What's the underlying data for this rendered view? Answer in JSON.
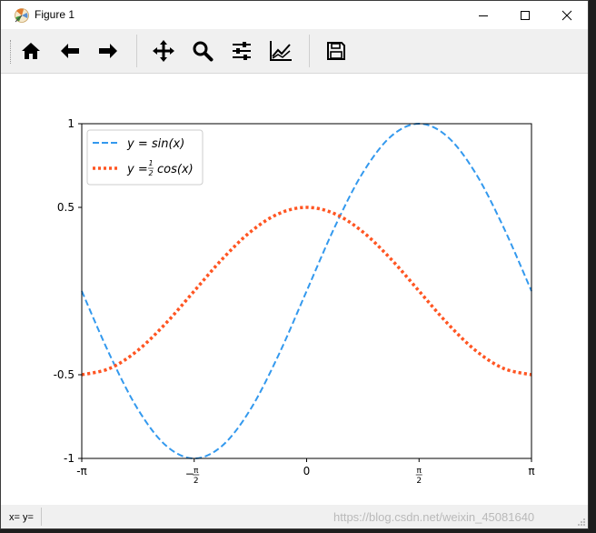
{
  "window": {
    "title": "Figure 1",
    "controls": [
      "minimize",
      "maximize",
      "close"
    ]
  },
  "toolbar": {
    "buttons": [
      {
        "name": "home",
        "icon": "home-icon"
      },
      {
        "name": "back",
        "icon": "arrow-left-icon"
      },
      {
        "name": "forward",
        "icon": "arrow-right-icon"
      },
      {
        "name": "pan",
        "icon": "move-icon"
      },
      {
        "name": "zoom",
        "icon": "magnifier-icon"
      },
      {
        "name": "configure-subplots",
        "icon": "sliders-icon"
      },
      {
        "name": "edit-axes",
        "icon": "line-chart-icon"
      },
      {
        "name": "save",
        "icon": "floppy-disk-icon"
      }
    ]
  },
  "status": {
    "coords": "x= y=",
    "watermark": "https://blog.csdn.net/weixin_45081640"
  },
  "colors": {
    "sin": "#3399ee",
    "cos": "#ff5522",
    "toolbar_bg": "#f0f0f0"
  },
  "chart_data": {
    "type": "line",
    "xlim": [
      -3.14159,
      3.14159
    ],
    "ylim": [
      -1,
      1
    ],
    "x_ticks": [
      {
        "value": -3.14159,
        "label": "-π"
      },
      {
        "value": -1.5708,
        "label": "-π/2"
      },
      {
        "value": 0,
        "label": "0"
      },
      {
        "value": 1.5708,
        "label": "π/2"
      },
      {
        "value": 3.14159,
        "label": "π"
      }
    ],
    "y_ticks": [
      {
        "value": -1,
        "label": "-1"
      },
      {
        "value": -0.5,
        "label": "-0.5"
      },
      {
        "value": 0.5,
        "label": "0.5"
      },
      {
        "value": 1,
        "label": "1"
      }
    ],
    "series": [
      {
        "name": "y = sin(x)",
        "style": "dashed",
        "color": "#3399ee",
        "x": [
          -3.1416,
          -2.7489,
          -2.3562,
          -1.9635,
          -1.5708,
          -1.1781,
          -0.7854,
          -0.3927,
          0,
          0.3927,
          0.7854,
          1.1781,
          1.5708,
          1.9635,
          2.3562,
          2.7489,
          3.1416
        ],
        "y": [
          0,
          -0.3827,
          -0.7071,
          -0.9239,
          -1,
          -0.9239,
          -0.7071,
          -0.3827,
          0,
          0.3827,
          0.7071,
          0.9239,
          1,
          0.9239,
          0.7071,
          0.3827,
          0
        ]
      },
      {
        "name": "y = 1/2 cos(x)",
        "style": "dotted",
        "color": "#ff5522",
        "x": [
          -3.1416,
          -2.7489,
          -2.3562,
          -1.9635,
          -1.5708,
          -1.1781,
          -0.7854,
          -0.3927,
          0,
          0.3927,
          0.7854,
          1.1781,
          1.5708,
          1.9635,
          2.3562,
          2.7489,
          3.1416
        ],
        "y": [
          -0.5,
          -0.4619,
          -0.3536,
          -0.1913,
          0,
          0.1913,
          0.3536,
          0.4619,
          0.5,
          0.4619,
          0.3536,
          0.1913,
          0,
          -0.1913,
          -0.3536,
          -0.4619,
          -0.5
        ]
      }
    ],
    "legend": {
      "placement": "upper-left",
      "entries": [
        {
          "text_prefix": "y = ",
          "text_func": "sin(x)"
        },
        {
          "text_prefix": "y = ",
          "frac_num": "1",
          "frac_den": "2",
          "text_func": "cos(x)"
        }
      ]
    }
  }
}
